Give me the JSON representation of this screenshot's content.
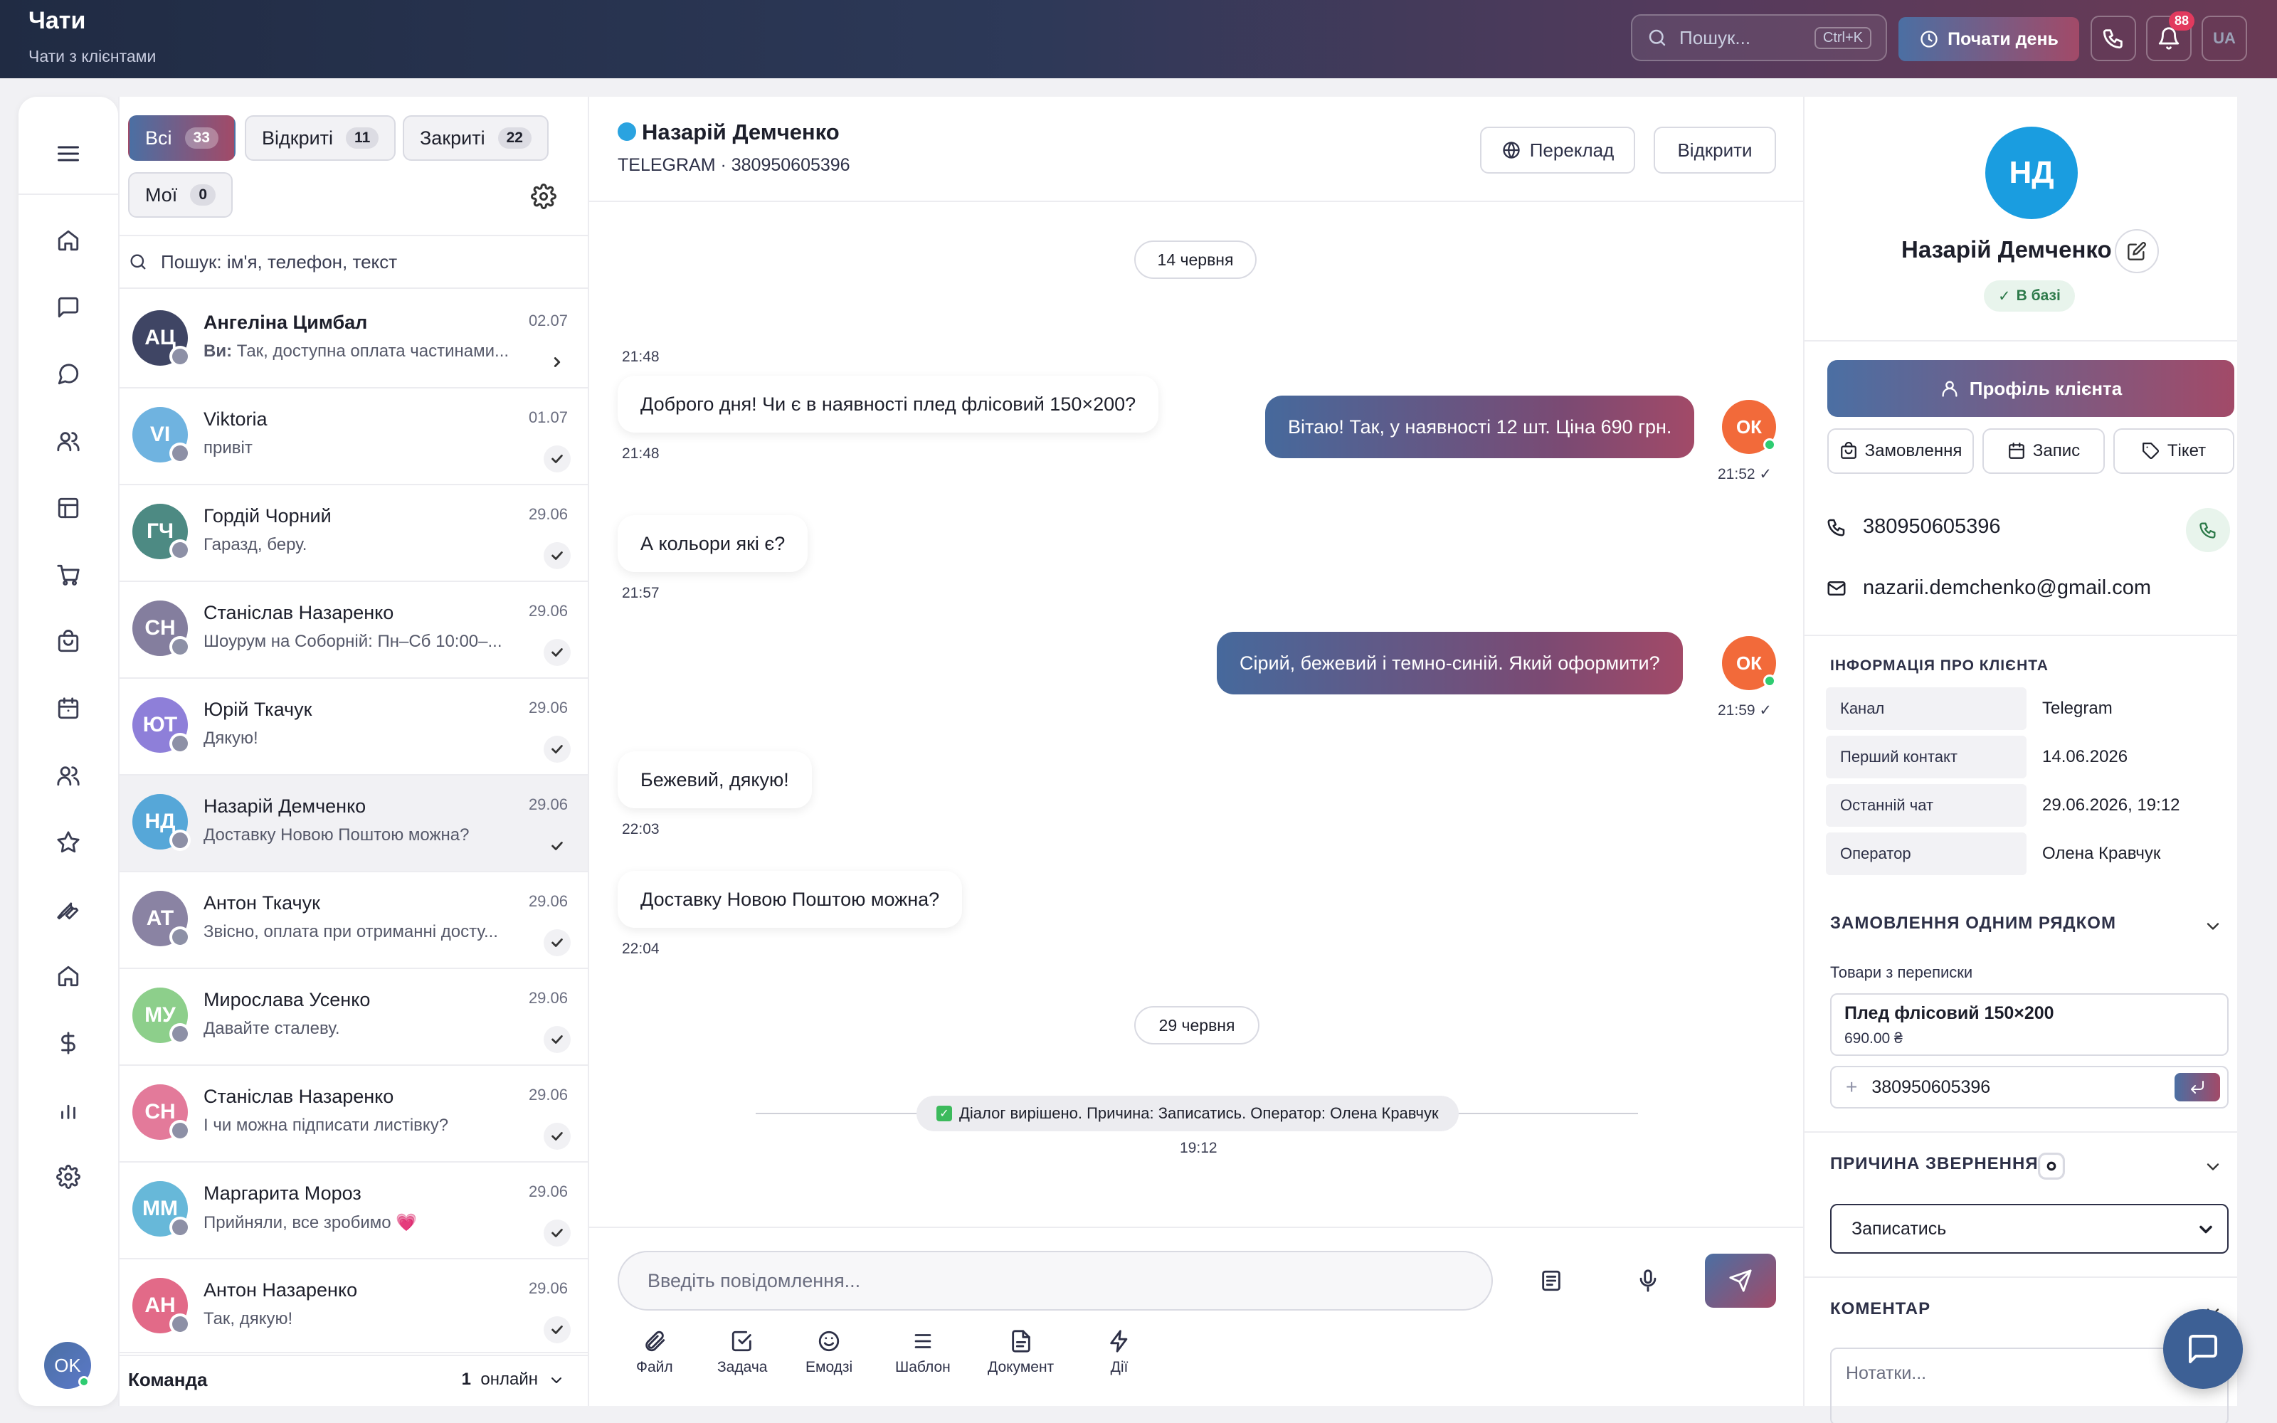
{
  "header": {
    "title": "Чати",
    "subtitle": "Чати з клієнтами",
    "search_placeholder": "Пошук...",
    "search_shortcut": "Ctrl+K",
    "start_day": "Почати день",
    "notif_count": "88",
    "lang": "UA"
  },
  "sidebar": {
    "user_initials": "OK",
    "items": [
      "home-icon",
      "message-square-icon",
      "message-circle-icon",
      "users-icon",
      "layout-icon",
      "cart-icon",
      "bag-icon",
      "calendar-icon",
      "users-2-icon",
      "star-icon",
      "wrench-icon",
      "home-2-icon",
      "dollar-icon",
      "bar-chart-icon",
      "gear-icon"
    ]
  },
  "list": {
    "filters": [
      {
        "label": "Всі",
        "count": "33"
      },
      {
        "label": "Відкриті",
        "count": "11"
      },
      {
        "label": "Закриті",
        "count": "22"
      },
      {
        "label": "Мої",
        "count": "0"
      }
    ],
    "search_placeholder": "Пошук: ім'я, телефон, текст",
    "chats": [
      {
        "initials": "АЦ",
        "name": "Ангеліна Цимбал",
        "prefix": "Ви: ",
        "preview": "Так, доступна оплата частинами...",
        "date": "02.07",
        "color": "#3f4564",
        "channel": "generic",
        "bold": true
      },
      {
        "initials": "VI",
        "name": "Viktoria",
        "prefix": "",
        "preview": "привіт",
        "date": "01.07",
        "color": "#6fb3e0",
        "channel": "telegram",
        "bold": false
      },
      {
        "initials": "ГЧ",
        "name": "Гордій Чорний",
        "prefix": "",
        "preview": "Гаразд, беру.",
        "date": "29.06",
        "color": "#4d8a83",
        "channel": "olx",
        "bold": false
      },
      {
        "initials": "СН",
        "name": "Станіслав Назаренко",
        "prefix": "",
        "preview": "Шоурум на Соборній: Пн–Сб 10:00–...",
        "date": "29.06",
        "color": "#847e9e",
        "channel": "generic",
        "bold": false
      },
      {
        "initials": "ЮТ",
        "name": "Юрій Ткачук",
        "prefix": "",
        "preview": "Дякую!",
        "date": "29.06",
        "color": "#8e7fd9",
        "channel": "viber",
        "bold": false
      },
      {
        "initials": "НД",
        "name": "Назарій Демченко",
        "prefix": "",
        "preview": "Доставку Новою Поштою можна?",
        "date": "29.06",
        "color": "#56a7d8",
        "channel": "telegram",
        "bold": false
      },
      {
        "initials": "АТ",
        "name": "Антон Ткачук",
        "prefix": "",
        "preview": "Звісно, оплата при отриманні досту...",
        "date": "29.06",
        "color": "#8a83a3",
        "channel": "generic",
        "bold": false
      },
      {
        "initials": "МУ",
        "name": "Мирослава Усенко",
        "prefix": "",
        "preview": "Давайте сталеву.",
        "date": "29.06",
        "color": "#8dcf8b",
        "channel": "chat",
        "bold": false
      },
      {
        "initials": "СН",
        "name": "Станіслав Назаренко",
        "prefix": "",
        "preview": "І чи можна підписати листівку?",
        "date": "29.06",
        "color": "#e37a9a",
        "channel": "instagram",
        "bold": false
      },
      {
        "initials": "ММ",
        "name": "Маргарита Мороз",
        "prefix": "",
        "preview": "Прийняли, все зробимо 💗",
        "date": "29.06",
        "color": "#67b8d9",
        "channel": "telegram",
        "bold": false
      },
      {
        "initials": "АН",
        "name": "Антон Назаренко",
        "prefix": "",
        "preview": "Так, дякую!",
        "date": "29.06",
        "color": "#e26a88",
        "channel": "instagram",
        "bold": false
      }
    ],
    "team": {
      "label": "Команда",
      "online_count": "1",
      "online_label": "онлайн"
    }
  },
  "chat": {
    "name": "Назарій Демченко",
    "meta": "TELEGRAM · 380950605396",
    "translate_label": "Переклад",
    "open_label": "Відкрити",
    "date1": "14 червня",
    "date2": "29 червня",
    "messages": [
      {
        "dir": "in",
        "text": "Доброго дня! Чи є в наявності плед флісовий 150×200?",
        "time": "21:48"
      },
      {
        "dir": "out",
        "text": "Вітаю! Так, у наявності 12 шт. Ціна 690 грн.",
        "time": "21:52 ✓",
        "avatar": "ОК"
      },
      {
        "dir": "in",
        "text": "А кольори які є?",
        "time": "21:57"
      },
      {
        "dir": "out",
        "text": "Сірий, бежевий і темно-синій. Який оформити?",
        "time": "21:59 ✓",
        "avatar": "ОК"
      },
      {
        "dir": "in",
        "text": "Бежевий, дякую!",
        "time": "22:03"
      },
      {
        "dir": "in",
        "text": "Доставку Новою Поштою можна?",
        "time": "22:04"
      }
    ],
    "system_msg": "Діалог вирішено. Причина: Записатись. Оператор: Олена Кравчук",
    "system_time": "19:12",
    "input_placeholder": "Введіть повідомлення...",
    "tools": [
      "Файл",
      "Задача",
      "Емодзі",
      "Шаблон",
      "Документ",
      "Дії"
    ]
  },
  "panel": {
    "initials": "НД",
    "name": "Назарій Демченко",
    "badge": "В базі",
    "profile_btn": "Профіль клієнта",
    "quick": [
      "Замовлення",
      "Запис",
      "Тікет"
    ],
    "phone": "380950605396",
    "email": "nazarii.demchenko@gmail.com",
    "info_title": "ІНФОРМАЦІЯ ПРО КЛІЄНТА",
    "info": [
      {
        "k": "Канал",
        "v": "Telegram"
      },
      {
        "k": "Перший контакт",
        "v": "14.06.2026"
      },
      {
        "k": "Останній чат",
        "v": "29.06.2026, 19:12"
      },
      {
        "k": "Оператор",
        "v": "Олена Кравчук"
      }
    ],
    "order_title": "ЗАМОВЛЕННЯ ОДНИМ РЯДКОМ",
    "goods_label": "Товари з переписки",
    "goods_name": "Плед флісовий 150×200",
    "goods_price": "690.00 ₴",
    "order_phone": "380950605396",
    "reason_title": "ПРИЧИНА ЗВЕРНЕННЯ",
    "reason_value": "Записатись",
    "comment_title": "КОМЕНТАР",
    "comment_placeholder": "Нотатки..."
  }
}
